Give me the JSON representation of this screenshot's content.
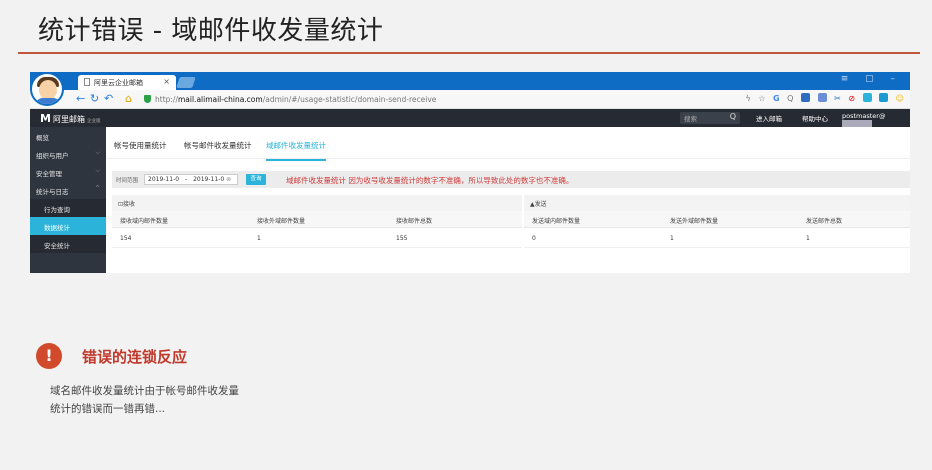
{
  "slide": {
    "title": "统计错误 - 域邮件收发量统计",
    "callout_icon": "!",
    "callout_title": "错误的连锁反应",
    "callout_line1": "域名邮件收发量统计由于帐号邮件收发量",
    "callout_line2": "统计的错误而一错再错..."
  },
  "browser": {
    "tab_title": "阿里云企业邮箱",
    "tab_close": "×",
    "url_protocol": "http://",
    "url_host": "mail.alimail-china.com",
    "url_path": "/admin/#/usage-statistic/domain-send-receive",
    "window_controls": "≡ ▢ –"
  },
  "app": {
    "logo_mark": "M",
    "logo_text": "阿里邮箱",
    "logo_sub": "企业版",
    "search_placeholder": "搜索",
    "search_icon": "Q",
    "links": [
      "进入邮箱",
      "帮助中心"
    ],
    "user": "postmaster@"
  },
  "sidebar": {
    "items": [
      {
        "label": "概览",
        "chev": ""
      },
      {
        "label": "组织与用户",
        "chev": "⌵"
      },
      {
        "label": "安全管理",
        "chev": "⌵"
      },
      {
        "label": "统计与日志",
        "chev": "^"
      },
      {
        "label": "行为查询",
        "chev": ""
      },
      {
        "label": "数据统计",
        "chev": ""
      },
      {
        "label": "安全统计",
        "chev": ""
      }
    ]
  },
  "tabs": [
    "帐号使用量统计",
    "帐号邮件收发量统计",
    "域邮件收发量统计"
  ],
  "filter": {
    "label": "时间范围",
    "date_start": "2019-11-0",
    "date_sep": "-",
    "date_end": "2019-11-0",
    "button": "查询",
    "note": "域邮件收发量统计  因为收号收发量统计的数字不准确，所以导致此处的数字也不准确。"
  },
  "table": {
    "receive_group": "接收",
    "send_group": "发送",
    "headers": [
      "接收域内邮件数量",
      "接收外域邮件数量",
      "接收邮件总数",
      "发送域内邮件数量",
      "发送外域邮件数量",
      "发送邮件总数"
    ],
    "values": [
      "154",
      "1",
      "155",
      "0",
      "1",
      "1"
    ]
  }
}
